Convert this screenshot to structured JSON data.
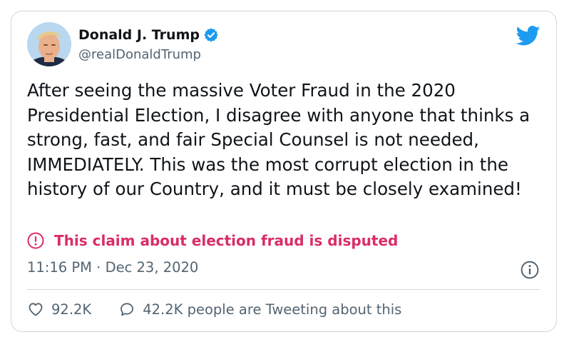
{
  "author": {
    "display_name": "Donald J. Trump",
    "handle": "@realDonaldTrump",
    "verified": true,
    "avatar": "profile-photo"
  },
  "tweet": {
    "text": "After seeing the massive Voter Fraud in the 2020 Presidential Election, I disagree with anyone that thinks a strong, fast, and fair Special Counsel is not needed, IMMEDIATELY. This was the most corrupt election in the history of our Country, and it must be closely examined!",
    "disputed_label": "This claim about election fraud is disputed",
    "timestamp": "11:16 PM · Dec 23, 2020"
  },
  "stats": {
    "likes": "92.2K",
    "conversation": "42.2K people are Tweeting about this"
  },
  "icons": {
    "brand": "twitter-bird-icon",
    "verified": "verified-badge-icon",
    "alert": "alert-circle-icon",
    "info": "info-icon",
    "like": "heart-icon",
    "reply": "comment-bubble-icon"
  },
  "colors": {
    "twitter_blue": "#1d9bf0",
    "disputed_red": "#d92d67",
    "secondary_text": "#536471",
    "border": "#cfd9de"
  }
}
